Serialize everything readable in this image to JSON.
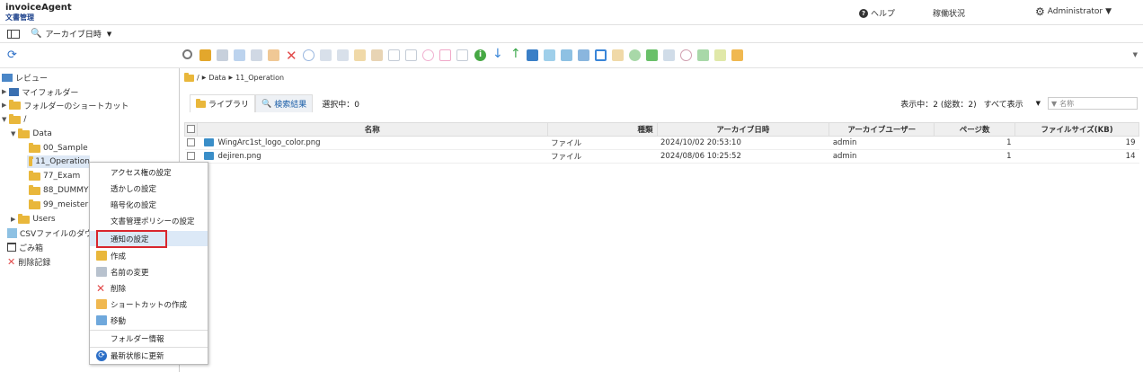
{
  "header": {
    "app_name": "invoiceAgent",
    "app_sub": "文書管理",
    "help": "ヘルプ",
    "status": "稼働状況",
    "user": "Administrator"
  },
  "subbar": {
    "search_mode": "アーカイブ日時"
  },
  "sidebar": {
    "items": [
      {
        "label": "レビュー"
      },
      {
        "label": "マイフォルダー"
      },
      {
        "label": "フォルダーのショートカット"
      },
      {
        "label": "/"
      },
      {
        "label": "Data"
      },
      {
        "label": "00_Sample"
      },
      {
        "label": "11_Operation"
      },
      {
        "label": "77_Exam"
      },
      {
        "label": "88_DUMMY"
      },
      {
        "label": "99_meister"
      },
      {
        "label": "Users"
      },
      {
        "label": "CSVファイルのダウン"
      },
      {
        "label": "ごみ箱"
      },
      {
        "label": "削除記録"
      }
    ]
  },
  "breadcrumb": {
    "root": "/",
    "p1": "Data",
    "p2": "11_Operation"
  },
  "tabs": {
    "library": "ライブラリ",
    "search": "検索結果",
    "selected": "選択中：0"
  },
  "toolbar_right": {
    "showing": "表示中：2 (総数：2)",
    "filter_select": "すべて表示",
    "filter_placeholder": "名称"
  },
  "table": {
    "headers": [
      "名称",
      "種類",
      "アーカイブ日時",
      "アーカイブユーザー",
      "ページ数",
      "ファイルサイズ(KB)"
    ],
    "rows": [
      {
        "name": "WingArc1st_logo_color.png",
        "type": "ファイル",
        "date": "2024/10/02 20:53:10",
        "user": "admin",
        "pages": "1",
        "size": "19"
      },
      {
        "name": "dejiren.png",
        "type": "ファイル",
        "date": "2024/08/06 10:25:52",
        "user": "admin",
        "pages": "1",
        "size": "14"
      }
    ]
  },
  "context_menu": {
    "items": [
      {
        "label": "アクセス権の設定"
      },
      {
        "label": "透かしの設定"
      },
      {
        "label": "暗号化の設定"
      },
      {
        "label": "文書管理ポリシーの設定"
      },
      {
        "label": "通知の設定"
      },
      {
        "label": "作成"
      },
      {
        "label": "名前の変更"
      },
      {
        "label": "削除"
      },
      {
        "label": "ショートカットの作成"
      },
      {
        "label": "移動"
      },
      {
        "label": "フォルダー情報"
      },
      {
        "label": "最新状態に更新"
      }
    ]
  }
}
